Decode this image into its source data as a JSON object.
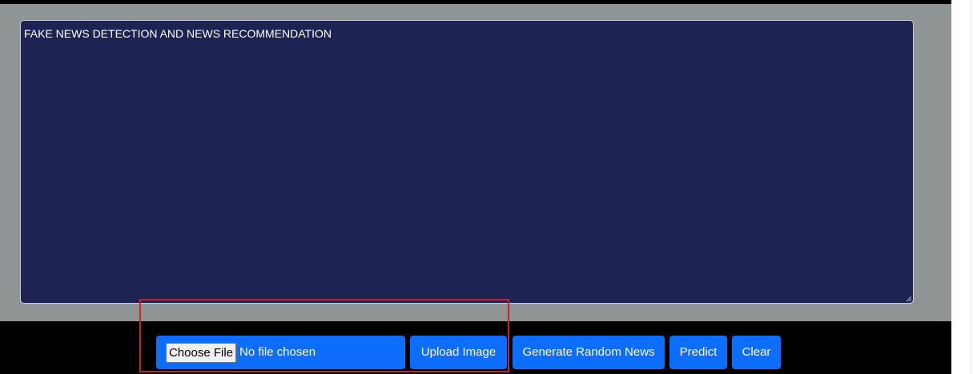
{
  "app": {
    "title": "FAKE NEWS DETECTION AND NEWS RECOMMENDATION"
  },
  "file_input": {
    "button_label": "Choose File",
    "status_text": "No file chosen"
  },
  "toolbar": {
    "upload_label": "Upload Image",
    "generate_label": "Generate Random News",
    "predict_label": "Predict",
    "clear_label": "Clear"
  },
  "colors": {
    "textarea_background": "#1d2352",
    "panel_background": "#8e9594",
    "button_primary": "#0d6efd",
    "toolbar_background": "#000000",
    "highlight_outline": "#d01f2c"
  }
}
